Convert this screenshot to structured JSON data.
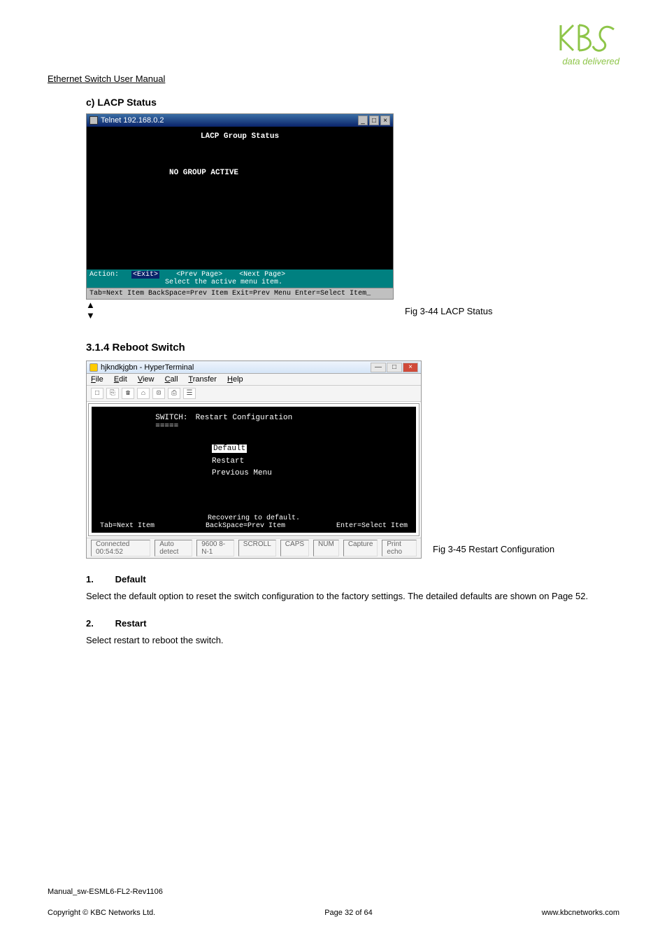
{
  "header": {
    "manual_title": "Ethernet Switch User Manual",
    "logo_text": "KBC",
    "logo_sub": "data delivered"
  },
  "section_c": {
    "heading": "c)   LACP Status",
    "window": {
      "title": "Telnet 192.168.0.2",
      "screen_title": "LACP Group Status",
      "no_active": "NO GROUP ACTIVE",
      "action_label": "Action:",
      "exit": "<Exit>",
      "prev_page": "<Prev Page>",
      "next_page": "<Next Page>",
      "hint": "Select the active menu item.",
      "bottom": "Tab=Next Item    BackSpace=Prev Item    Exit=Prev Menu   Enter=Select Item_",
      "min": "_",
      "max": "□",
      "close": "×",
      "up": "▲",
      "down": "▼"
    },
    "caption": "Fig 3-44 LACP Status"
  },
  "section_314": {
    "heading": "3.1.4 Reboot Switch",
    "window": {
      "title": "hjkndkjgbn - HyperTerminal",
      "menu": {
        "file": "File",
        "edit": "Edit",
        "view": "View",
        "call": "Call",
        "transfer": "Transfer",
        "help": "Help"
      },
      "toolbar_icons": [
        "□",
        "⎘",
        "☎",
        "⌂",
        "⊡",
        "⎙",
        "☰"
      ],
      "switch_label": "SWITCH:",
      "switch_sub": "=====",
      "screen_title": "Restart Configuration",
      "items": {
        "default": "Default",
        "restart": "Restart",
        "prev": "Previous Menu"
      },
      "foot_mid": "Recovering to default.",
      "foot_tab": "Tab=Next Item",
      "foot_back": "BackSpace=Prev Item",
      "foot_enter": "Enter=Select Item",
      "status": {
        "connected": "Connected 00:54:52",
        "autodetect": "Auto detect",
        "baud": "9600 8-N-1",
        "scroll": "SCROLL",
        "caps": "CAPS",
        "num": "NUM",
        "capture": "Capture",
        "print": "Print echo"
      },
      "min": "—",
      "max": "□",
      "close": "×"
    },
    "caption": "Fig 3-45 Restart Configuration"
  },
  "subsections": {
    "s1_num": "1.",
    "s1_title": "Default",
    "s1_body": "Select the default option to reset the switch configuration to the factory settings. The detailed defaults are shown on Page 52.",
    "s2_num": "2.",
    "s2_title": "Restart",
    "s2_body": "Select restart to reboot the switch."
  },
  "footer": {
    "file_id": "Manual_sw-ESML6-FL2-Rev1106",
    "copyright": "Copyright © KBC Networks Ltd.",
    "page": "Page 32 of 64",
    "url": "www.kbcnetworks.com"
  }
}
